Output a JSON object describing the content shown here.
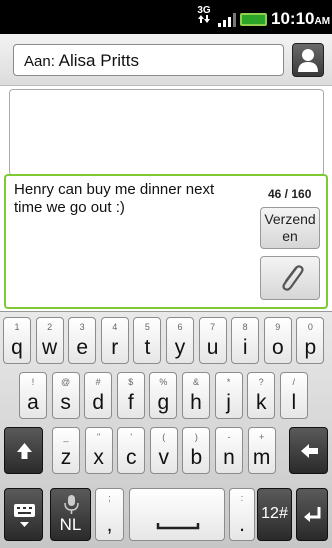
{
  "status": {
    "network": "3G",
    "time": "10:10",
    "ampm": "AM"
  },
  "to": {
    "label": "Aan:",
    "recipient": "Alisa Pritts"
  },
  "compose": {
    "text": "Henry can buy me dinner next time we go out :)",
    "char_count": "46 / 160",
    "send_label": "Verzend en"
  },
  "keyboard": {
    "row1": [
      {
        "main": "q",
        "alt": "1"
      },
      {
        "main": "w",
        "alt": "2"
      },
      {
        "main": "e",
        "alt": "3"
      },
      {
        "main": "r",
        "alt": "4"
      },
      {
        "main": "t",
        "alt": "5"
      },
      {
        "main": "y",
        "alt": "6"
      },
      {
        "main": "u",
        "alt": "7"
      },
      {
        "main": "i",
        "alt": "8"
      },
      {
        "main": "o",
        "alt": "9"
      },
      {
        "main": "p",
        "alt": "0"
      }
    ],
    "row2": [
      {
        "main": "a",
        "alt": "!"
      },
      {
        "main": "s",
        "alt": "@"
      },
      {
        "main": "d",
        "alt": "#"
      },
      {
        "main": "f",
        "alt": "$"
      },
      {
        "main": "g",
        "alt": "%"
      },
      {
        "main": "h",
        "alt": "&"
      },
      {
        "main": "j",
        "alt": "*"
      },
      {
        "main": "k",
        "alt": "?"
      },
      {
        "main": "l",
        "alt": "/"
      }
    ],
    "row3": [
      {
        "main": "z",
        "alt": "_"
      },
      {
        "main": "x",
        "alt": "\""
      },
      {
        "main": "c",
        "alt": "'"
      },
      {
        "main": "v",
        "alt": "("
      },
      {
        "main": "b",
        "alt": ")"
      },
      {
        "main": "n",
        "alt": "-"
      },
      {
        "main": "m",
        "alt": "+"
      }
    ],
    "lang": "NL",
    "comma": ",",
    "comma_alt": ";",
    "period": ".",
    "period_alt": ":",
    "numsym": "12#"
  }
}
